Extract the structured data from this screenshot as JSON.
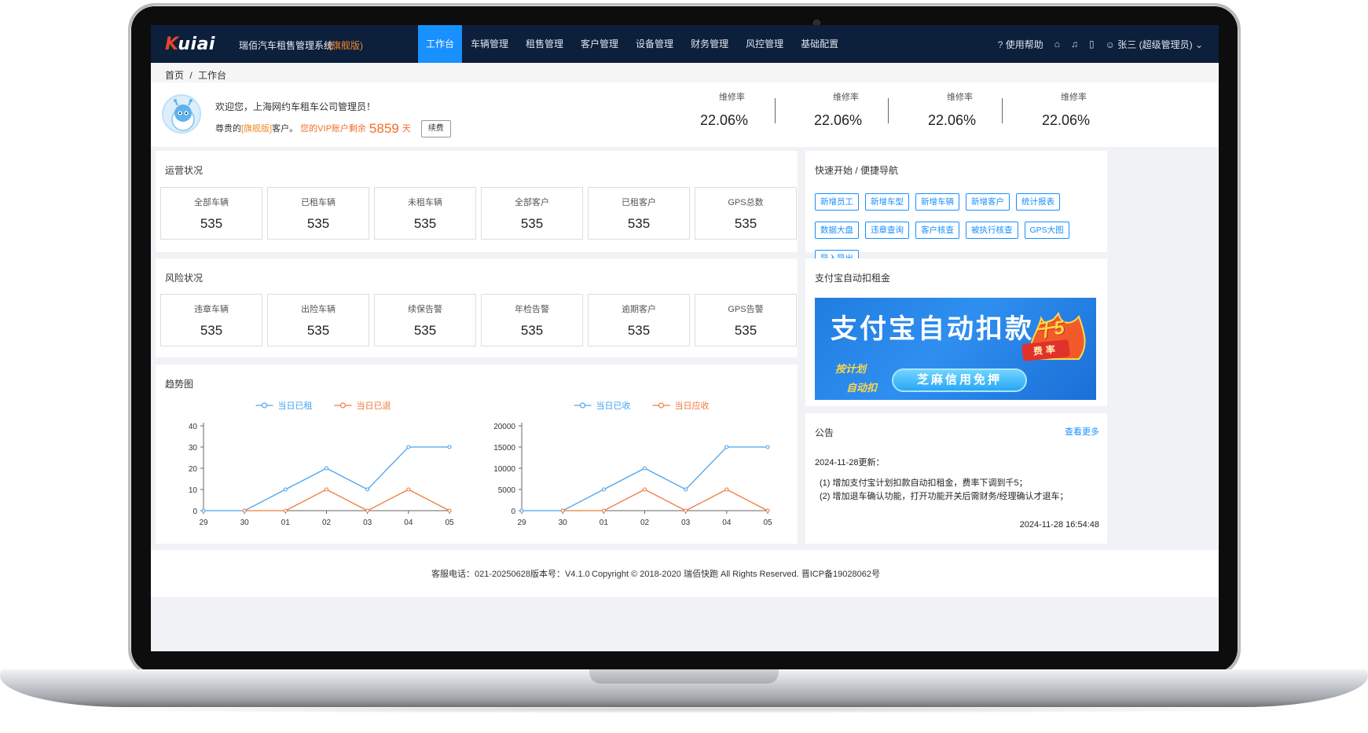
{
  "header": {
    "logo_text": "Kuiai",
    "app_title": "瑞佰汽车租售管理系统",
    "edition": "(旗舰版)",
    "nav": [
      "工作台",
      "车辆管理",
      "租售管理",
      "客户管理",
      "设备管理",
      "财务管理",
      "风控管理",
      "基础配置"
    ],
    "active_nav_index": 0,
    "help_label": "使用帮助",
    "user_label": "张三 (超级管理员)"
  },
  "breadcrumb": {
    "home": "首页",
    "separator": "/",
    "current": "工作台"
  },
  "welcome": {
    "greeting": "欢迎您，上海网约车租车公司管理员！",
    "prefix": "尊贵的",
    "edition": "[旗舰版]",
    "customer": "客户。",
    "vip_text": "您的VIP账户剩余",
    "vip_days": "5859",
    "days_unit": "天",
    "renew_label": "续费"
  },
  "stats": [
    {
      "label": "维修率",
      "value": "22.06%"
    },
    {
      "label": "维修率",
      "value": "22.06%"
    },
    {
      "label": "维修率",
      "value": "22.06%"
    },
    {
      "label": "维修率",
      "value": "22.06%"
    }
  ],
  "operations": {
    "title": "运营状况",
    "items": [
      {
        "label": "全部车辆",
        "value": "535"
      },
      {
        "label": "已租车辆",
        "value": "535"
      },
      {
        "label": "未租车辆",
        "value": "535"
      },
      {
        "label": "全部客户",
        "value": "535"
      },
      {
        "label": "已租客户",
        "value": "535"
      },
      {
        "label": "GPS总数",
        "value": "535"
      }
    ]
  },
  "risk": {
    "title": "风险状况",
    "items": [
      {
        "label": "违章车辆",
        "value": "535"
      },
      {
        "label": "出险车辆",
        "value": "535"
      },
      {
        "label": "续保告警",
        "value": "535"
      },
      {
        "label": "年检告警",
        "value": "535"
      },
      {
        "label": "逾期客户",
        "value": "535"
      },
      {
        "label": "GPS告警",
        "value": "535"
      }
    ]
  },
  "trend": {
    "title": "趋势图"
  },
  "chart_data": [
    {
      "type": "line",
      "categories": [
        "29",
        "30",
        "01",
        "02",
        "03",
        "04",
        "05"
      ],
      "ylim": [
        0,
        40
      ],
      "yticks": [
        0,
        10,
        20,
        30,
        40
      ],
      "grid": false,
      "legend": "top-center",
      "series": [
        {
          "name": "当日已租",
          "color": "#4aa3f0",
          "values": [
            0,
            0,
            10,
            20,
            10,
            30,
            30
          ]
        },
        {
          "name": "当日已退",
          "color": "#f07a3e",
          "values": [
            null,
            0,
            0,
            10,
            0,
            10,
            0
          ]
        }
      ]
    },
    {
      "type": "line",
      "categories": [
        "29",
        "30",
        "01",
        "02",
        "03",
        "04",
        "05"
      ],
      "ylim": [
        0,
        20000
      ],
      "yticks": [
        0,
        5000,
        10000,
        15000,
        20000
      ],
      "grid": false,
      "legend": "top-center",
      "series": [
        {
          "name": "当日已收",
          "color": "#4aa3f0",
          "values": [
            0,
            0,
            5000,
            10000,
            5000,
            15000,
            15000
          ]
        },
        {
          "name": "当日应收",
          "color": "#f07a3e",
          "values": [
            null,
            0,
            0,
            5000,
            0,
            5000,
            0
          ]
        }
      ]
    }
  ],
  "quick_nav": {
    "title": "快速开始 / 便捷导航",
    "buttons": [
      "新增员工",
      "新增车型",
      "新增车辆",
      "新增客户",
      "统计报表",
      "数据大盘",
      "违章查询",
      "客户核查",
      "被执行核查",
      "GPS大图",
      "导入导出"
    ]
  },
  "alipay": {
    "title": "支付宝自动扣租金",
    "banner_title": "支付宝自动扣款",
    "banner_badge": "千5",
    "banner_rate": "费率",
    "banner_sub1": "按计划",
    "banner_sub2": "自动扣",
    "banner_pill": "芝麻信用免押"
  },
  "notice": {
    "title": "公告",
    "more_label": "查看更多",
    "date_line": "2024-11-28更新：",
    "items": [
      "(1) 增加支付宝计划扣款自动扣租金，费率下调到千5；",
      "(2) 增加退车确认功能，打开功能开关后需财务/经理确认才退车；"
    ],
    "timestamp": "2024-11-28 16:54:48"
  },
  "footer": {
    "left": "客服电话：021-20250628版本号：V4.1.0",
    "right": "Copyright © 2018-2020 瑞佰快跑 All Rights Reserved. 晋ICP备19028062号"
  },
  "colors": {
    "nav_bg": "#0c1f3b",
    "accent": "#1890ff",
    "orange": "#f08a2c",
    "vip": "#f56c2a"
  }
}
